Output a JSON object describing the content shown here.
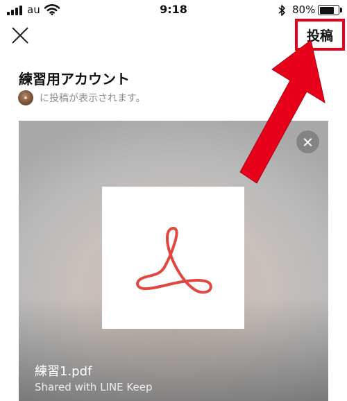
{
  "status_bar": {
    "carrier": "au",
    "time": "9:18",
    "bluetooth_glyph": "✱",
    "battery_percent": "80%",
    "battery_level": 0.8
  },
  "nav": {
    "close_icon": "close-icon",
    "post_label": "投稿",
    "highlight_color": "#e6001a"
  },
  "account": {
    "name": "練習用アカウント",
    "notice": "に投稿が表示されます。"
  },
  "attachment": {
    "file_name": "練習1.pdf",
    "meta": "Shared with LINE Keep",
    "thumbnail_icon": "pdf-icon",
    "remove_icon": "remove-icon"
  }
}
